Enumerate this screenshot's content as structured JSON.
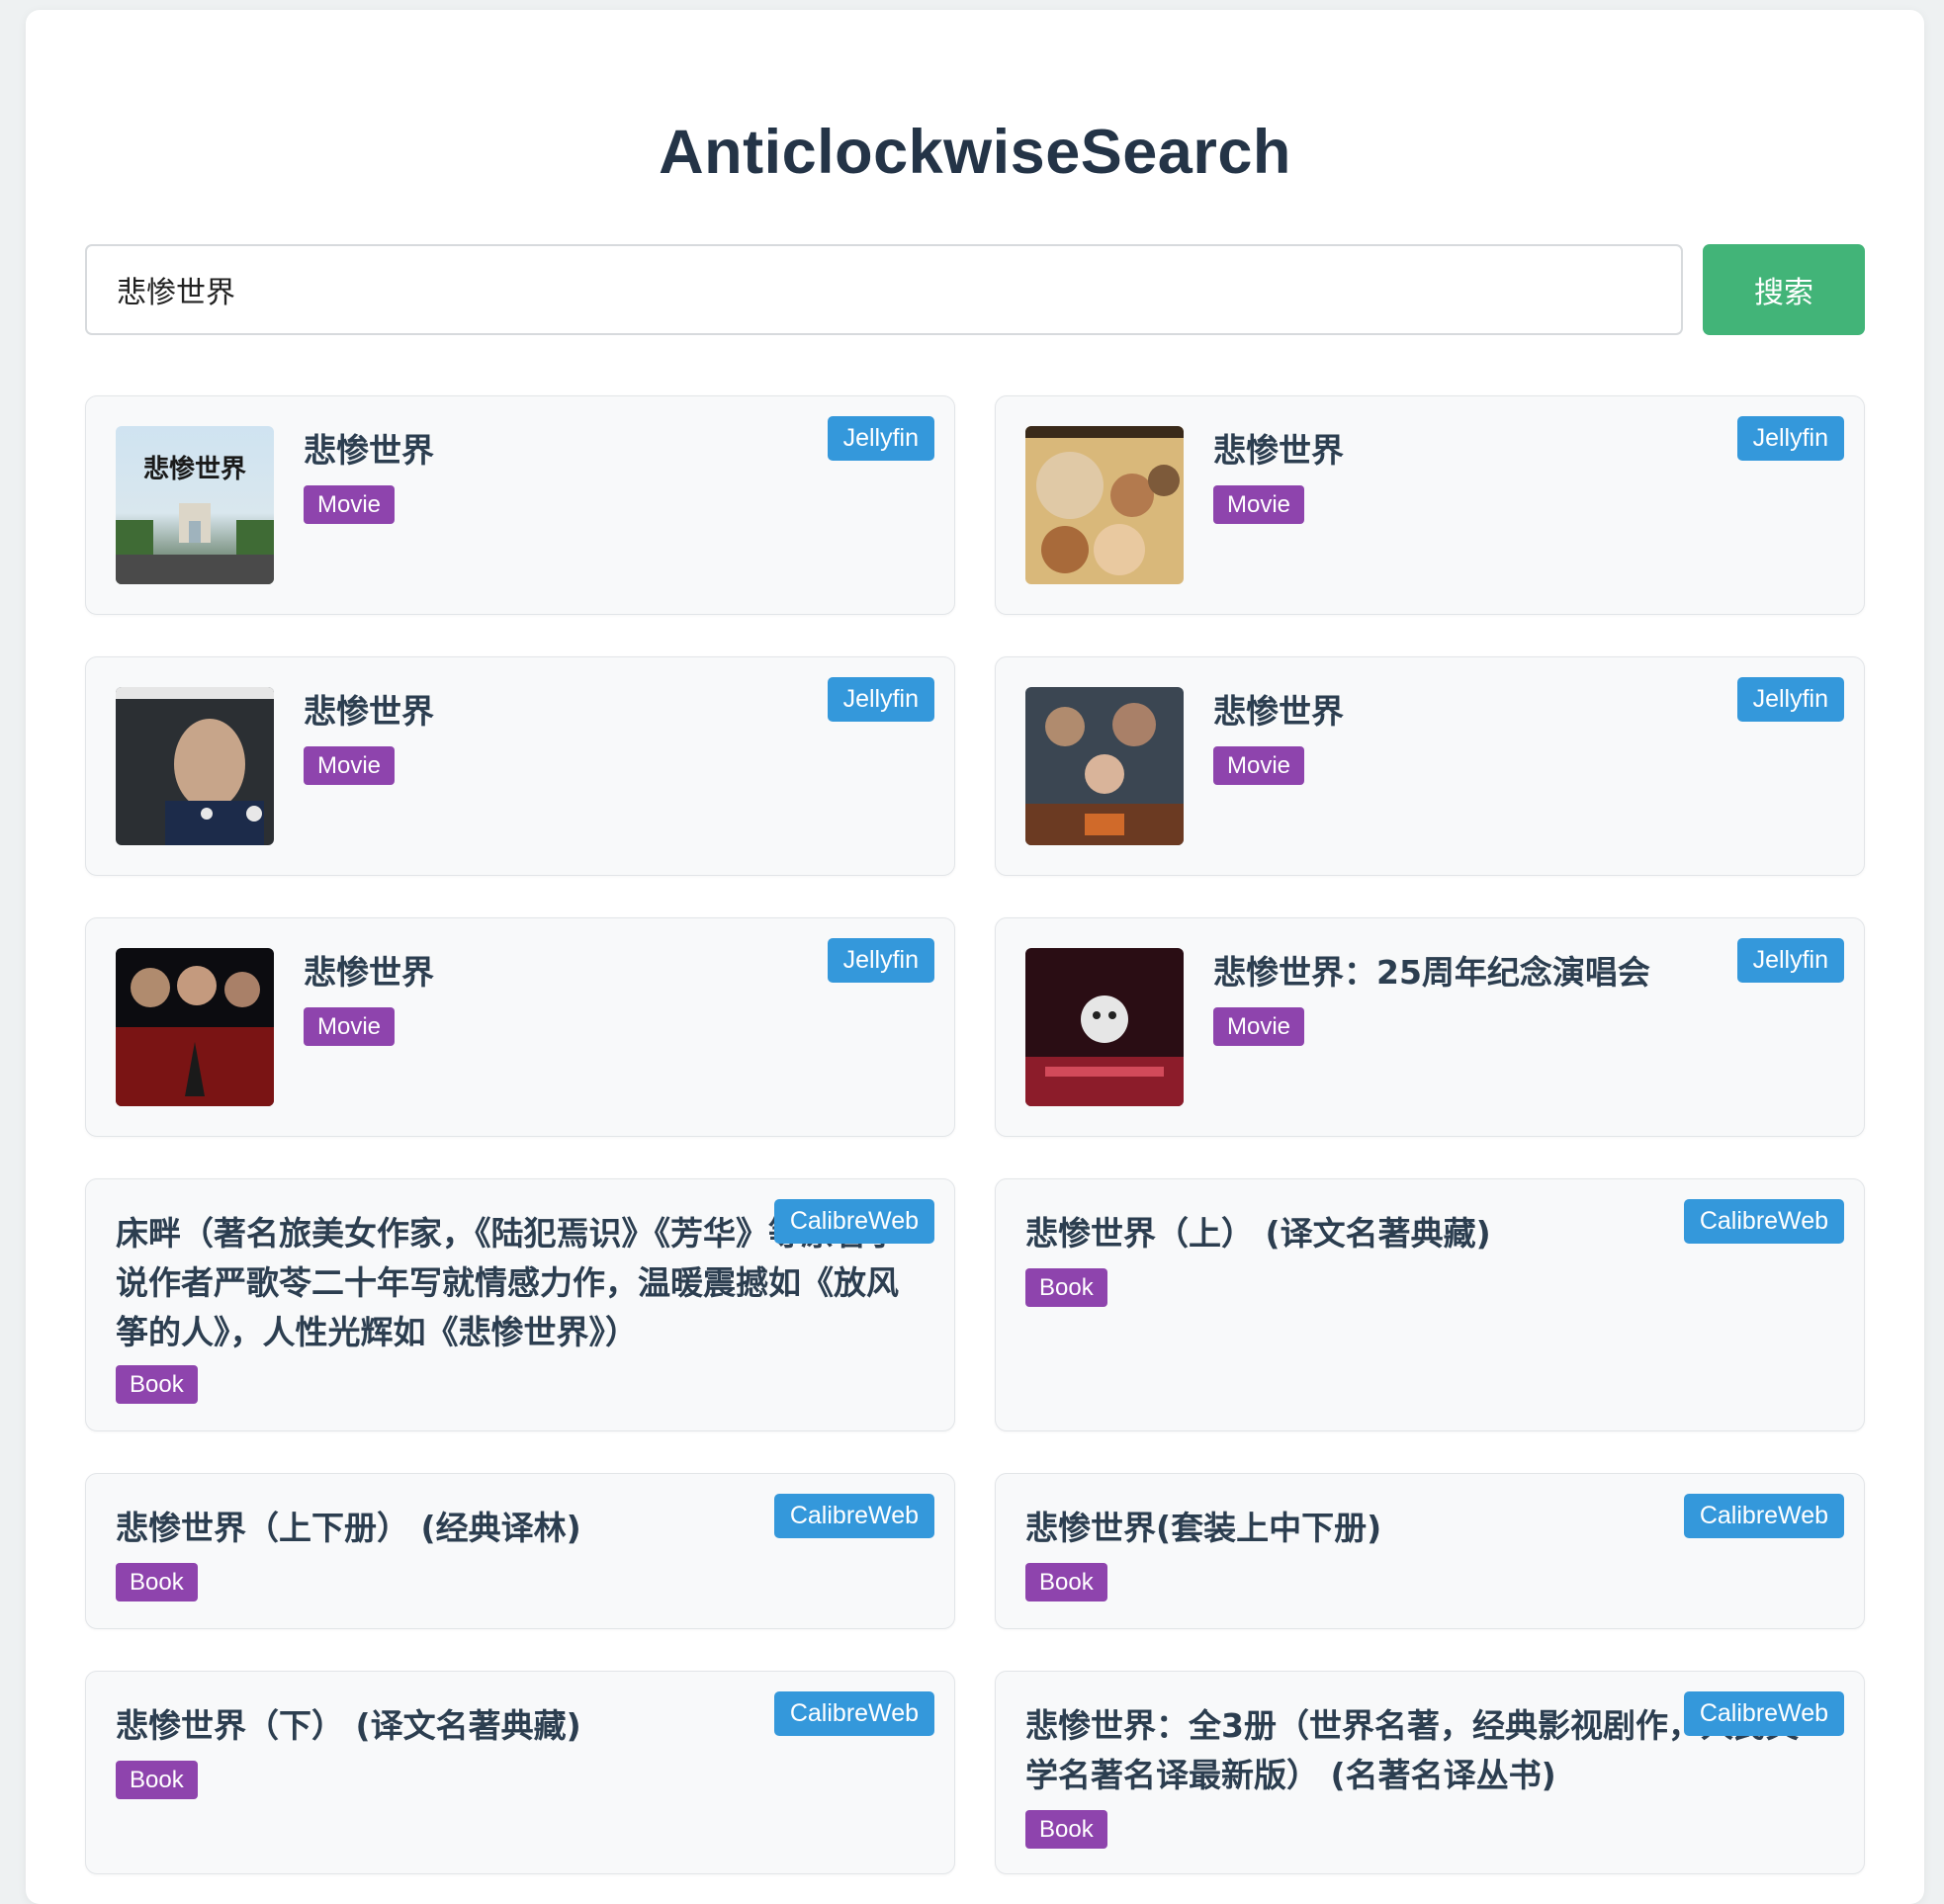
{
  "app": {
    "title": "AnticlockwiseSearch"
  },
  "search": {
    "value": "悲惨世界",
    "button_label": "搜索"
  },
  "results": [
    {
      "title": "悲惨世界",
      "type": "Movie",
      "source": "Jellyfin",
      "poster_icon": "movie-poster-icon"
    },
    {
      "title": "悲惨世界",
      "type": "Movie",
      "source": "Jellyfin",
      "poster_icon": "movie-poster-icon"
    },
    {
      "title": "悲惨世界",
      "type": "Movie",
      "source": "Jellyfin",
      "poster_icon": "movie-poster-icon"
    },
    {
      "title": "悲惨世界",
      "type": "Movie",
      "source": "Jellyfin",
      "poster_icon": "movie-poster-icon"
    },
    {
      "title": "悲惨世界",
      "type": "Movie",
      "source": "Jellyfin",
      "poster_icon": "movie-poster-icon"
    },
    {
      "title": "悲惨世界：25周年纪念演唱会",
      "type": "Movie",
      "source": "Jellyfin",
      "poster_icon": "movie-poster-icon"
    },
    {
      "title": "床畔（著名旅美女作家，《陆犯焉识》《芳华》等原著小说作者严歌苓二十年写就情感力作，温暖震撼如《放风筝的人》，人性光辉如《悲惨世界》）",
      "type": "Book",
      "source": "CalibreWeb"
    },
    {
      "title": "悲惨世界（上） (译文名著典藏)",
      "type": "Book",
      "source": "CalibreWeb"
    },
    {
      "title": "悲惨世界（上下册） (经典译林)",
      "type": "Book",
      "source": "CalibreWeb"
    },
    {
      "title": "悲惨世界(套装上中下册)",
      "type": "Book",
      "source": "CalibreWeb"
    },
    {
      "title": "悲惨世界（下） (译文名著典藏)",
      "type": "Book",
      "source": "CalibreWeb"
    },
    {
      "title": "悲惨世界：全3册（世界名著，经典影视剧作，人民文学名著名译最新版） (名著名译丛书)",
      "type": "Book",
      "source": "CalibreWeb"
    }
  ],
  "colors": {
    "accent_green": "#42b478",
    "source_blue": "#3498db",
    "type_purple": "#8e44ad"
  }
}
